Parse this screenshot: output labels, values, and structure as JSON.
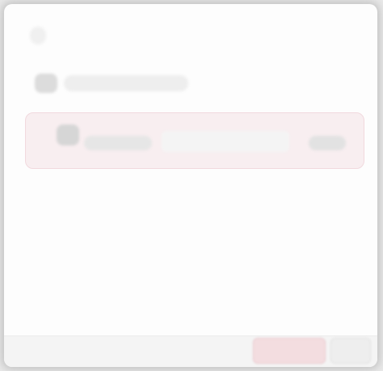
{
  "dialog": {
    "title": "",
    "section": {
      "label": "",
      "icon": "folder-icon"
    },
    "item": {
      "name": "",
      "field_value": "",
      "value": "",
      "icon": "item-icon"
    },
    "footer": {
      "primary_label": "",
      "secondary_label": ""
    }
  },
  "colors": {
    "background": "#fdfdfd",
    "highlight_row": "#f8eef0",
    "highlight_border": "#f1d9de",
    "primary_button": "#f3dde0"
  }
}
